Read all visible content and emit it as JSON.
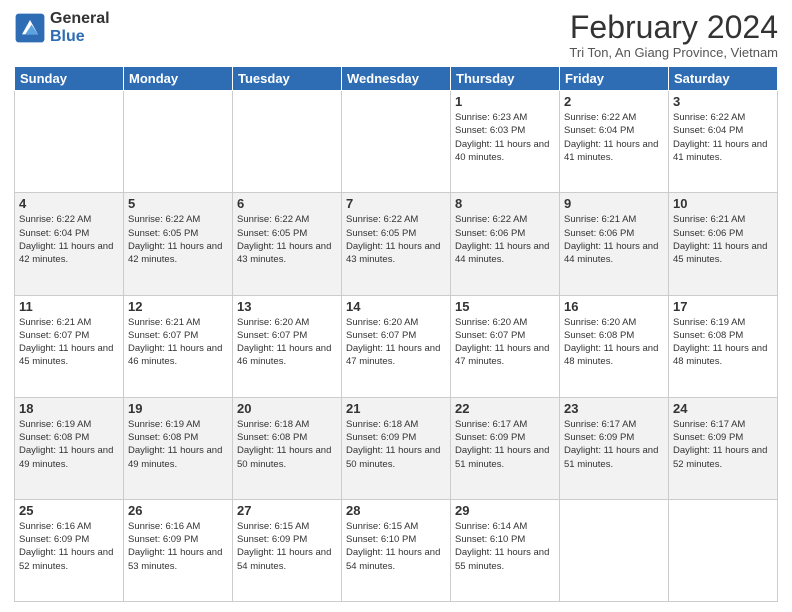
{
  "logo": {
    "general": "General",
    "blue": "Blue"
  },
  "title": "February 2024",
  "location": "Tri Ton, An Giang Province, Vietnam",
  "days_of_week": [
    "Sunday",
    "Monday",
    "Tuesday",
    "Wednesday",
    "Thursday",
    "Friday",
    "Saturday"
  ],
  "weeks": [
    [
      {
        "day": "",
        "info": ""
      },
      {
        "day": "",
        "info": ""
      },
      {
        "day": "",
        "info": ""
      },
      {
        "day": "",
        "info": ""
      },
      {
        "day": "1",
        "info": "Sunrise: 6:23 AM\nSunset: 6:03 PM\nDaylight: 11 hours and 40 minutes."
      },
      {
        "day": "2",
        "info": "Sunrise: 6:22 AM\nSunset: 6:04 PM\nDaylight: 11 hours and 41 minutes."
      },
      {
        "day": "3",
        "info": "Sunrise: 6:22 AM\nSunset: 6:04 PM\nDaylight: 11 hours and 41 minutes."
      }
    ],
    [
      {
        "day": "4",
        "info": "Sunrise: 6:22 AM\nSunset: 6:04 PM\nDaylight: 11 hours and 42 minutes."
      },
      {
        "day": "5",
        "info": "Sunrise: 6:22 AM\nSunset: 6:05 PM\nDaylight: 11 hours and 42 minutes."
      },
      {
        "day": "6",
        "info": "Sunrise: 6:22 AM\nSunset: 6:05 PM\nDaylight: 11 hours and 43 minutes."
      },
      {
        "day": "7",
        "info": "Sunrise: 6:22 AM\nSunset: 6:05 PM\nDaylight: 11 hours and 43 minutes."
      },
      {
        "day": "8",
        "info": "Sunrise: 6:22 AM\nSunset: 6:06 PM\nDaylight: 11 hours and 44 minutes."
      },
      {
        "day": "9",
        "info": "Sunrise: 6:21 AM\nSunset: 6:06 PM\nDaylight: 11 hours and 44 minutes."
      },
      {
        "day": "10",
        "info": "Sunrise: 6:21 AM\nSunset: 6:06 PM\nDaylight: 11 hours and 45 minutes."
      }
    ],
    [
      {
        "day": "11",
        "info": "Sunrise: 6:21 AM\nSunset: 6:07 PM\nDaylight: 11 hours and 45 minutes."
      },
      {
        "day": "12",
        "info": "Sunrise: 6:21 AM\nSunset: 6:07 PM\nDaylight: 11 hours and 46 minutes."
      },
      {
        "day": "13",
        "info": "Sunrise: 6:20 AM\nSunset: 6:07 PM\nDaylight: 11 hours and 46 minutes."
      },
      {
        "day": "14",
        "info": "Sunrise: 6:20 AM\nSunset: 6:07 PM\nDaylight: 11 hours and 47 minutes."
      },
      {
        "day": "15",
        "info": "Sunrise: 6:20 AM\nSunset: 6:07 PM\nDaylight: 11 hours and 47 minutes."
      },
      {
        "day": "16",
        "info": "Sunrise: 6:20 AM\nSunset: 6:08 PM\nDaylight: 11 hours and 48 minutes."
      },
      {
        "day": "17",
        "info": "Sunrise: 6:19 AM\nSunset: 6:08 PM\nDaylight: 11 hours and 48 minutes."
      }
    ],
    [
      {
        "day": "18",
        "info": "Sunrise: 6:19 AM\nSunset: 6:08 PM\nDaylight: 11 hours and 49 minutes."
      },
      {
        "day": "19",
        "info": "Sunrise: 6:19 AM\nSunset: 6:08 PM\nDaylight: 11 hours and 49 minutes."
      },
      {
        "day": "20",
        "info": "Sunrise: 6:18 AM\nSunset: 6:08 PM\nDaylight: 11 hours and 50 minutes."
      },
      {
        "day": "21",
        "info": "Sunrise: 6:18 AM\nSunset: 6:09 PM\nDaylight: 11 hours and 50 minutes."
      },
      {
        "day": "22",
        "info": "Sunrise: 6:17 AM\nSunset: 6:09 PM\nDaylight: 11 hours and 51 minutes."
      },
      {
        "day": "23",
        "info": "Sunrise: 6:17 AM\nSunset: 6:09 PM\nDaylight: 11 hours and 51 minutes."
      },
      {
        "day": "24",
        "info": "Sunrise: 6:17 AM\nSunset: 6:09 PM\nDaylight: 11 hours and 52 minutes."
      }
    ],
    [
      {
        "day": "25",
        "info": "Sunrise: 6:16 AM\nSunset: 6:09 PM\nDaylight: 11 hours and 52 minutes."
      },
      {
        "day": "26",
        "info": "Sunrise: 6:16 AM\nSunset: 6:09 PM\nDaylight: 11 hours and 53 minutes."
      },
      {
        "day": "27",
        "info": "Sunrise: 6:15 AM\nSunset: 6:09 PM\nDaylight: 11 hours and 54 minutes."
      },
      {
        "day": "28",
        "info": "Sunrise: 6:15 AM\nSunset: 6:10 PM\nDaylight: 11 hours and 54 minutes."
      },
      {
        "day": "29",
        "info": "Sunrise: 6:14 AM\nSunset: 6:10 PM\nDaylight: 11 hours and 55 minutes."
      },
      {
        "day": "",
        "info": ""
      },
      {
        "day": "",
        "info": ""
      }
    ]
  ]
}
